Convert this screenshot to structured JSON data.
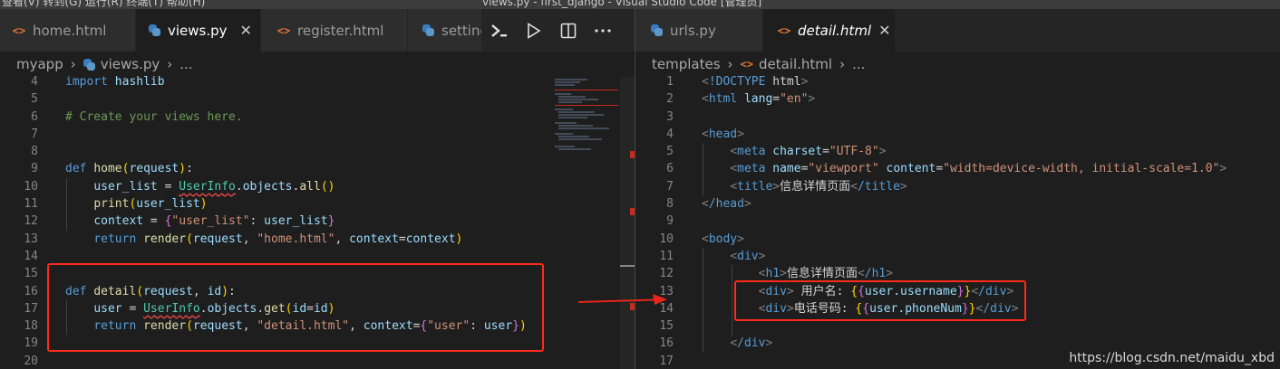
{
  "window": {
    "menu_fragment": "查看(V)   转到(G)   运行(R)   终端(T)   帮助(H)",
    "title_fragment": "views.py - first_django - Visual Studio Code [管理员]"
  },
  "left_pane": {
    "tabs": [
      {
        "label": "home.html",
        "icon": "html-file-icon",
        "active": false
      },
      {
        "label": "views.py",
        "icon": "python-file-icon",
        "active": true
      },
      {
        "label": "register.html",
        "icon": "html-file-icon",
        "active": false
      },
      {
        "label": "setting",
        "icon": "python-file-icon",
        "active": false
      }
    ],
    "close_glyph": "✕",
    "actions": [
      "run-terminal-icon",
      "run-play-icon",
      "split-editor-icon",
      "more-actions-icon"
    ],
    "breadcrumb": {
      "folder": "myapp",
      "file": "views.py",
      "rest": "..."
    },
    "lines": [
      {
        "n": "4",
        "text": "import hashlib"
      },
      {
        "n": "5",
        "text": ""
      },
      {
        "n": "6",
        "text": "# Create your views here."
      },
      {
        "n": "7",
        "text": ""
      },
      {
        "n": "8",
        "text": ""
      },
      {
        "n": "9",
        "text": "def home(request):"
      },
      {
        "n": "10",
        "text": "    user_list = UserInfo.objects.all()"
      },
      {
        "n": "11",
        "text": "    print(user_list)"
      },
      {
        "n": "12",
        "text": "    context = {\"user_list\": user_list}"
      },
      {
        "n": "13",
        "text": "    return render(request, \"home.html\", context=context)"
      },
      {
        "n": "14",
        "text": ""
      },
      {
        "n": "15",
        "text": ""
      },
      {
        "n": "16",
        "text": "def detail(request, id):"
      },
      {
        "n": "17",
        "text": "    user = UserInfo.objects.get(id=id)"
      },
      {
        "n": "18",
        "text": "    return render(request, \"detail.html\", context={\"user\": user})"
      },
      {
        "n": "19",
        "text": ""
      },
      {
        "n": "20",
        "text": ""
      }
    ]
  },
  "right_pane": {
    "tabs": [
      {
        "label": "urls.py",
        "icon": "python-file-icon",
        "active": false
      },
      {
        "label": "detail.html",
        "icon": "html-file-icon",
        "active": true
      }
    ],
    "close_glyph": "✕",
    "breadcrumb": {
      "folder": "templates",
      "file": "detail.html",
      "rest": "..."
    },
    "lines": [
      {
        "n": "1",
        "text": "<!DOCTYPE html>"
      },
      {
        "n": "2",
        "text": "<html lang=\"en\">"
      },
      {
        "n": "3",
        "text": ""
      },
      {
        "n": "4",
        "text": "<head>"
      },
      {
        "n": "5",
        "text": "    <meta charset=\"UTF-8\">"
      },
      {
        "n": "6",
        "text": "    <meta name=\"viewport\" content=\"width=device-width, initial-scale=1.0\">"
      },
      {
        "n": "7",
        "text": "    <title>信息详情页面</title>"
      },
      {
        "n": "8",
        "text": "</head>"
      },
      {
        "n": "9",
        "text": ""
      },
      {
        "n": "10",
        "text": "<body>"
      },
      {
        "n": "11",
        "text": "    <div>"
      },
      {
        "n": "12",
        "text": "        <h1>信息详情页面</h1>"
      },
      {
        "n": "13",
        "text": "        <div> 用户名: {{user.username}}</div>"
      },
      {
        "n": "14",
        "text": "        <div>电话号码: {{user.phoneNum}}</div>"
      },
      {
        "n": "15",
        "text": ""
      },
      {
        "n": "16",
        "text": "    </div>"
      },
      {
        "n": "17",
        "text": ""
      }
    ]
  },
  "watermark": "https://blog.csdn.net/maidu_xbd",
  "colors": {
    "highlight_box": "#ff2a1a",
    "arrow": "#e8251a",
    "editor_bg": "#1e1e1e"
  }
}
